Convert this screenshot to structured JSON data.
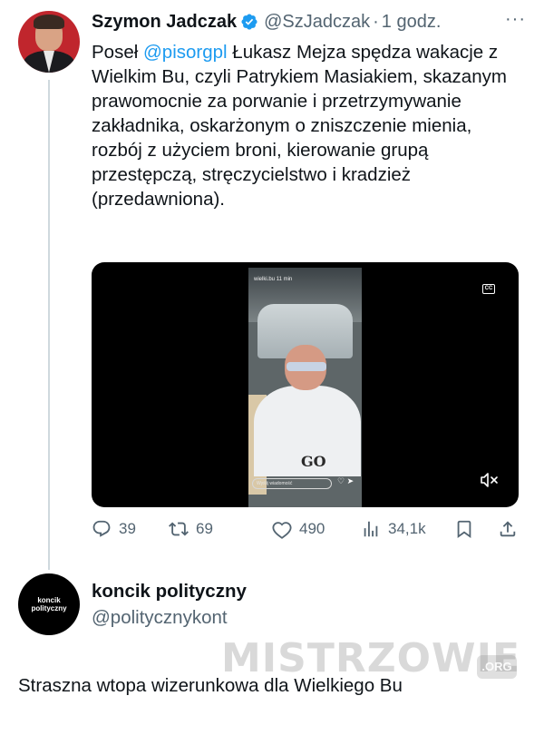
{
  "tweet": {
    "author_name": "Szymon Jadczak",
    "handle": "@SzJadczak",
    "separator": "·",
    "time": "1 godz.",
    "more": "···",
    "text_before_mention": "Poseł ",
    "mention": "@pisorgpl",
    "text_after_mention": " Łukasz Mejza spędza wakacje z Wielkim Bu, czyli Patrykiem Masiakiem, skazanym prawomocnie za porwanie i przetrzymywanie zakładnika, oskarżonym o zniszczenie mienia, rozbój z użyciem broni, kierowanie grupą przestępczą, stręczycielstwo i kradzież (przedawniona).",
    "video": {
      "story_user": "wielki.bu",
      "story_time": "11 min",
      "story_overlay": "GO",
      "story_input_placeholder": "Wyślij wiadomość",
      "captions_label": "CC"
    },
    "actions": {
      "replies": "39",
      "reposts": "69",
      "likes": "490",
      "views": "34,1k"
    }
  },
  "quote": {
    "avatar_text_line1": "koncik",
    "avatar_text_line2": "polityczny",
    "name": "koncik polityczny",
    "handle": "@politycznykont",
    "text": "Straszna wtopa wizerunkowa dla Wielkiego Bu"
  },
  "watermark": {
    "text": "MISTRZOWIE",
    "tld": ".ORG"
  },
  "colors": {
    "accent": "#1d9bf0",
    "muted": "#536471",
    "text": "#0f1419"
  }
}
